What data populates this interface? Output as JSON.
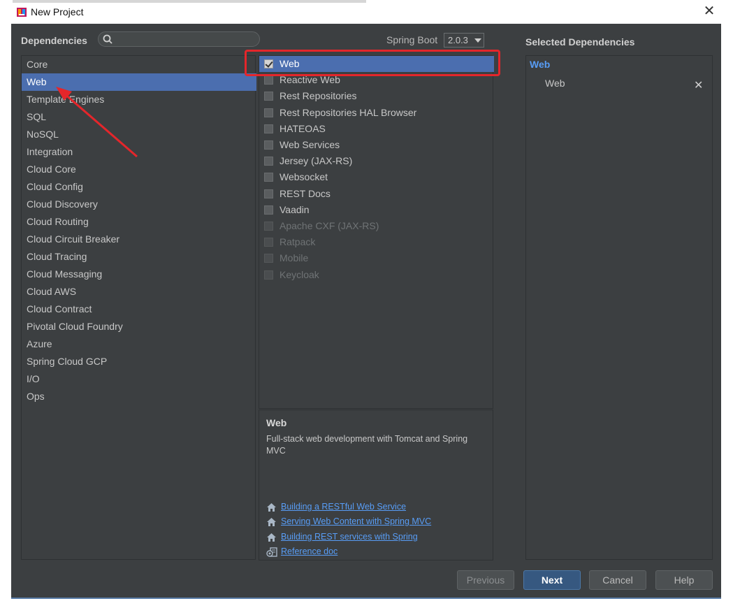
{
  "window": {
    "title": "New Project",
    "close_glyph": "✕"
  },
  "header": {
    "dependencies_label": "Dependencies",
    "spring_boot_label": "Spring Boot",
    "spring_boot_version": "2.0.3",
    "selected_label": "Selected Dependencies"
  },
  "categories": [
    "Core",
    "Web",
    "Template Engines",
    "SQL",
    "NoSQL",
    "Integration",
    "Cloud Core",
    "Cloud Config",
    "Cloud Discovery",
    "Cloud Routing",
    "Cloud Circuit Breaker",
    "Cloud Tracing",
    "Cloud Messaging",
    "Cloud AWS",
    "Cloud Contract",
    "Pivotal Cloud Foundry",
    "Azure",
    "Spring Cloud GCP",
    "I/O",
    "Ops"
  ],
  "dependencies": [
    {
      "label": "Web",
      "checked": true,
      "disabled": false
    },
    {
      "label": "Reactive Web",
      "checked": false,
      "disabled": false
    },
    {
      "label": "Rest Repositories",
      "checked": false,
      "disabled": false
    },
    {
      "label": "Rest Repositories HAL Browser",
      "checked": false,
      "disabled": false
    },
    {
      "label": "HATEOAS",
      "checked": false,
      "disabled": false
    },
    {
      "label": "Web Services",
      "checked": false,
      "disabled": false
    },
    {
      "label": "Jersey (JAX-RS)",
      "checked": false,
      "disabled": false
    },
    {
      "label": "Websocket",
      "checked": false,
      "disabled": false
    },
    {
      "label": "REST Docs",
      "checked": false,
      "disabled": false
    },
    {
      "label": "Vaadin",
      "checked": false,
      "disabled": false
    },
    {
      "label": "Apache CXF (JAX-RS)",
      "checked": false,
      "disabled": true
    },
    {
      "label": "Ratpack",
      "checked": false,
      "disabled": true
    },
    {
      "label": "Mobile",
      "checked": false,
      "disabled": true
    },
    {
      "label": "Keycloak",
      "checked": false,
      "disabled": true
    }
  ],
  "description": {
    "title": "Web",
    "text": "Full-stack web development with Tomcat and Spring MVC",
    "links": [
      {
        "label": "Building a RESTful Web Service",
        "icon": "home-icon"
      },
      {
        "label": "Serving Web Content with Spring MVC",
        "icon": "home-icon"
      },
      {
        "label": "Building REST services with Spring",
        "icon": "home-icon"
      },
      {
        "label": "Reference doc",
        "icon": "reference-doc-icon"
      }
    ]
  },
  "selected": {
    "group": "Web",
    "item": "Web",
    "remove_glyph": "✕"
  },
  "buttons": {
    "previous": "Previous",
    "next": "Next",
    "cancel": "Cancel",
    "help": "Help"
  },
  "colors": {
    "dialog_bg": "#3c3f41",
    "selection": "#4b6eaf",
    "link": "#589df6",
    "annotation_red": "#e4262b"
  }
}
